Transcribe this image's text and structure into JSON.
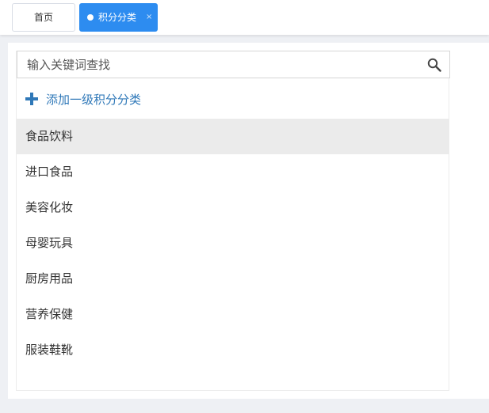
{
  "tabs": [
    {
      "label": "首页",
      "active": false
    },
    {
      "label": "积分分类",
      "active": true,
      "close_glyph": "×"
    }
  ],
  "search": {
    "placeholder": "输入关键词查找",
    "icon": "search-icon"
  },
  "add_button": {
    "icon": "plus-icon",
    "label": "添加一级积分分类"
  },
  "categories": [
    {
      "label": "食品饮料",
      "selected": true
    },
    {
      "label": "进口食品",
      "selected": false
    },
    {
      "label": "美容化妆",
      "selected": false
    },
    {
      "label": "母婴玩具",
      "selected": false
    },
    {
      "label": "厨房用品",
      "selected": false
    },
    {
      "label": "营养保健",
      "selected": false
    },
    {
      "label": "服装鞋靴",
      "selected": false
    }
  ],
  "colors": {
    "accent": "#2d8cf0",
    "link": "#2f78b8",
    "selected_row": "#ebebeb",
    "page_background": "#eef0f4"
  }
}
